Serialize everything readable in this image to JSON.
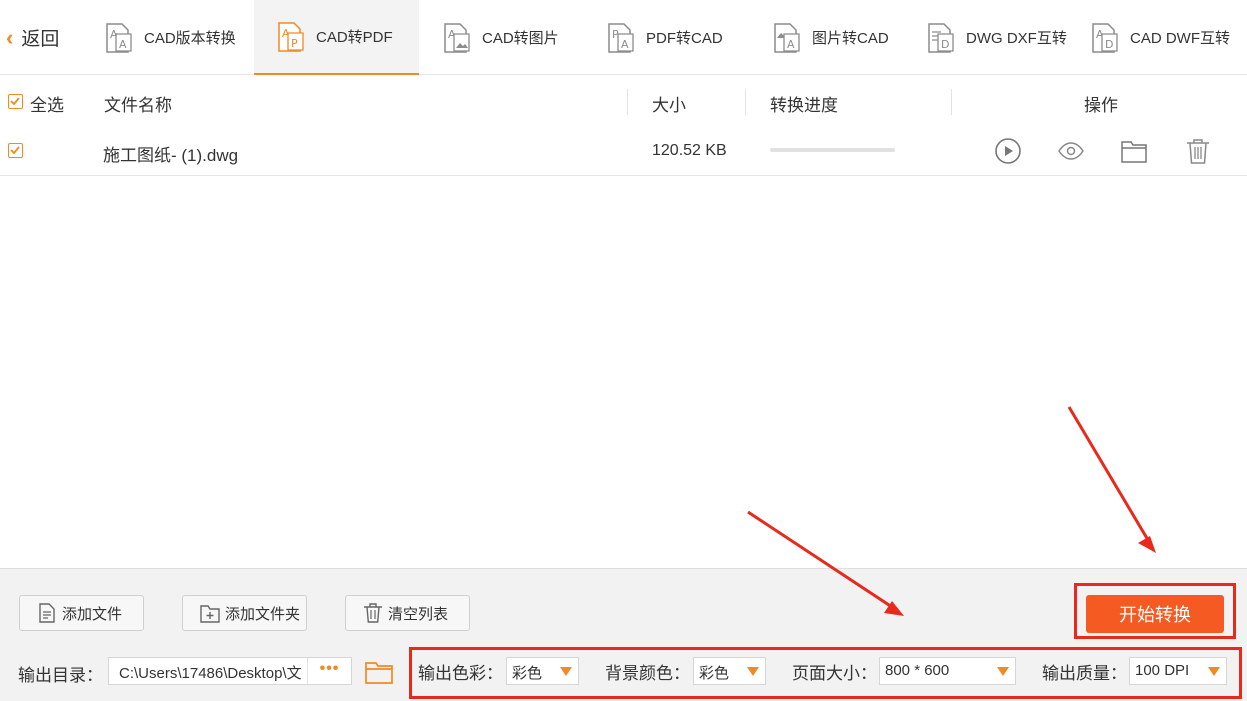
{
  "toolbar": {
    "back_label": "返回",
    "tabs": [
      {
        "label": "CAD版本转换"
      },
      {
        "label": "CAD转PDF"
      },
      {
        "label": "CAD转图片"
      },
      {
        "label": "PDF转CAD"
      },
      {
        "label": "图片转CAD"
      },
      {
        "label": "DWG DXF互转"
      },
      {
        "label": "CAD DWF互转"
      }
    ],
    "active_tab": "CAD转PDF"
  },
  "table": {
    "select_all_label": "全选",
    "headers": {
      "name": "文件名称",
      "size": "大小",
      "progress": "转换进度",
      "actions": "操作"
    },
    "rows": [
      {
        "checked": true,
        "name": "施工图纸- (1).dwg",
        "size": "120.52 KB",
        "progress": 0
      }
    ]
  },
  "bottom": {
    "add_file_label": "添加文件",
    "add_folder_label": "添加文件夹",
    "clear_list_label": "清空列表",
    "start_label": "开始转换",
    "output_dir_label": "输出目录：",
    "output_dir_value": "C:\\Users\\17486\\Desktop\\文",
    "browse_dots": "•••",
    "settings": {
      "color_label": "输出色彩：",
      "color_value": "彩色",
      "bg_label": "背景颜色：",
      "bg_value": "彩色",
      "page_label": "页面大小：",
      "page_value": "800 * 600",
      "quality_label": "输出质量：",
      "quality_value": "100 DPI"
    }
  },
  "colors": {
    "accent": "#f08a24",
    "start_button": "#f55a22",
    "highlight_frame": "#e8291c"
  }
}
